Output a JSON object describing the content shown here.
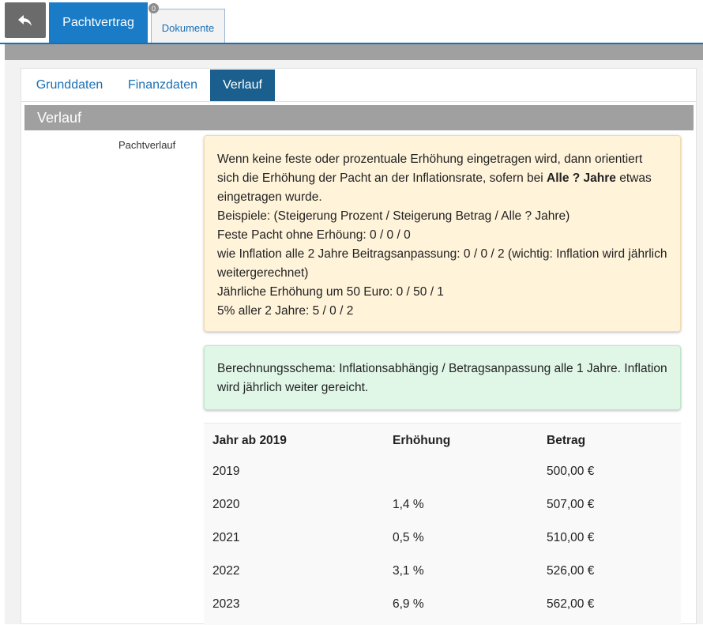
{
  "toolbar": {
    "back_icon": "reply-arrow-icon",
    "tab_pachtvertrag": "Pachtvertrag",
    "tab_dokumente": "Dokumente",
    "dokumente_badge": "0"
  },
  "subtabs": [
    "Grunddaten",
    "Finanzdaten",
    "Verlauf"
  ],
  "section": {
    "title": "Verlauf",
    "field_label": "Pachtverlauf"
  },
  "info_warn": {
    "line1_pre": "Wenn keine feste oder prozentuale Erhöhung eingetragen wird, dann orientiert sich die Erhöhung der Pacht an der Inflationsrate, sofern bei ",
    "line1_bold": "Alle ? Jahre",
    "line1_post": " etwas eingetragen wurde.",
    "lines": [
      "Beispiele: (Steigerung Prozent / Steigerung Betrag / Alle ? Jahre)",
      "Feste Pacht ohne Erhöung: 0 / 0 / 0",
      "wie Inflation alle 2 Jahre Beitragsanpassung: 0 / 0 / 2 (wichtig: Inflation wird jährlich weitergerechnet)",
      "Jährliche Erhöhung um 50 Euro: 0 / 50 / 1",
      "5% aller 2 Jahre: 5 / 0 / 2"
    ]
  },
  "info_green": {
    "text": "Berechnungsschema: Inflationsabhängig / Betragsanpassung alle 1 Jahre. Inflation wird jährlich weiter gereicht."
  },
  "table": {
    "headers": [
      "Jahr ab 2019",
      "Erhöhung",
      "Betrag"
    ],
    "rows": [
      [
        "2019",
        "",
        "500,00 €"
      ],
      [
        "2020",
        "1,4 %",
        "507,00 €"
      ],
      [
        "2021",
        "0,5 %",
        "510,00 €"
      ],
      [
        "2022",
        "3,1 %",
        "526,00 €"
      ],
      [
        "2023",
        "6,9 %",
        "562,00 €"
      ]
    ]
  }
}
